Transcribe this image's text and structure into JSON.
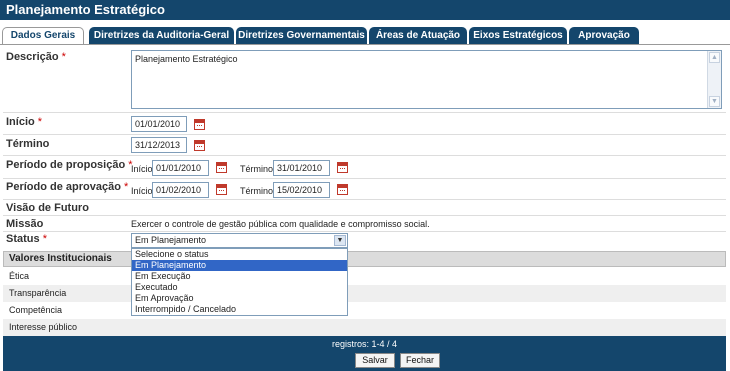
{
  "page": {
    "title": "Planejamento Estratégico"
  },
  "tabs": [
    {
      "label": "Dados Gerais",
      "active": true
    },
    {
      "label": "Diretrizes da Auditoria-Geral"
    },
    {
      "label": "Diretrizes Governamentais"
    },
    {
      "label": "Áreas de Atuação"
    },
    {
      "label": "Eixos Estratégicos"
    },
    {
      "label": "Aprovação"
    }
  ],
  "form": {
    "required_mark": "*",
    "descricao": {
      "label": "Descrição",
      "value": "Planejamento Estratégico"
    },
    "inicio": {
      "label": "Início",
      "value": "01/01/2010"
    },
    "termino": {
      "label": "Término",
      "value": "31/12/2013"
    },
    "periodo_proposicao": {
      "label": "Período de proposição",
      "inicio_label": "Início",
      "inicio_value": "01/01/2010",
      "termino_label": "Término",
      "termino_value": "31/01/2010"
    },
    "periodo_aprovacao": {
      "label": "Período de aprovação",
      "inicio_label": "Início",
      "inicio_value": "01/02/2010",
      "termino_label": "Término",
      "termino_value": "15/02/2010"
    },
    "visao": {
      "label": "Visão de Futuro",
      "value": ""
    },
    "missao": {
      "label": "Missão",
      "value": "Exercer o controle de gestão pública com qualidade e compromisso social."
    },
    "status": {
      "label": "Status",
      "selected": "Em Planejamento",
      "options": [
        "Selecione o status",
        "Em Planejamento",
        "Em Execução",
        "Executado",
        "Em Aprovação",
        "Interrompido / Cancelado"
      ]
    }
  },
  "valores": {
    "header": "Valores Institucionais",
    "rows": [
      "Ética",
      "Transparência",
      "Competência",
      "Interesse público"
    ]
  },
  "footer": {
    "count": "registros: 1-4 / 4",
    "save_label": "Salvar",
    "close_label": "Fechar"
  },
  "colors": {
    "primary": "#14466c",
    "selected_option": "#3166c6",
    "required": "#cc0000"
  }
}
